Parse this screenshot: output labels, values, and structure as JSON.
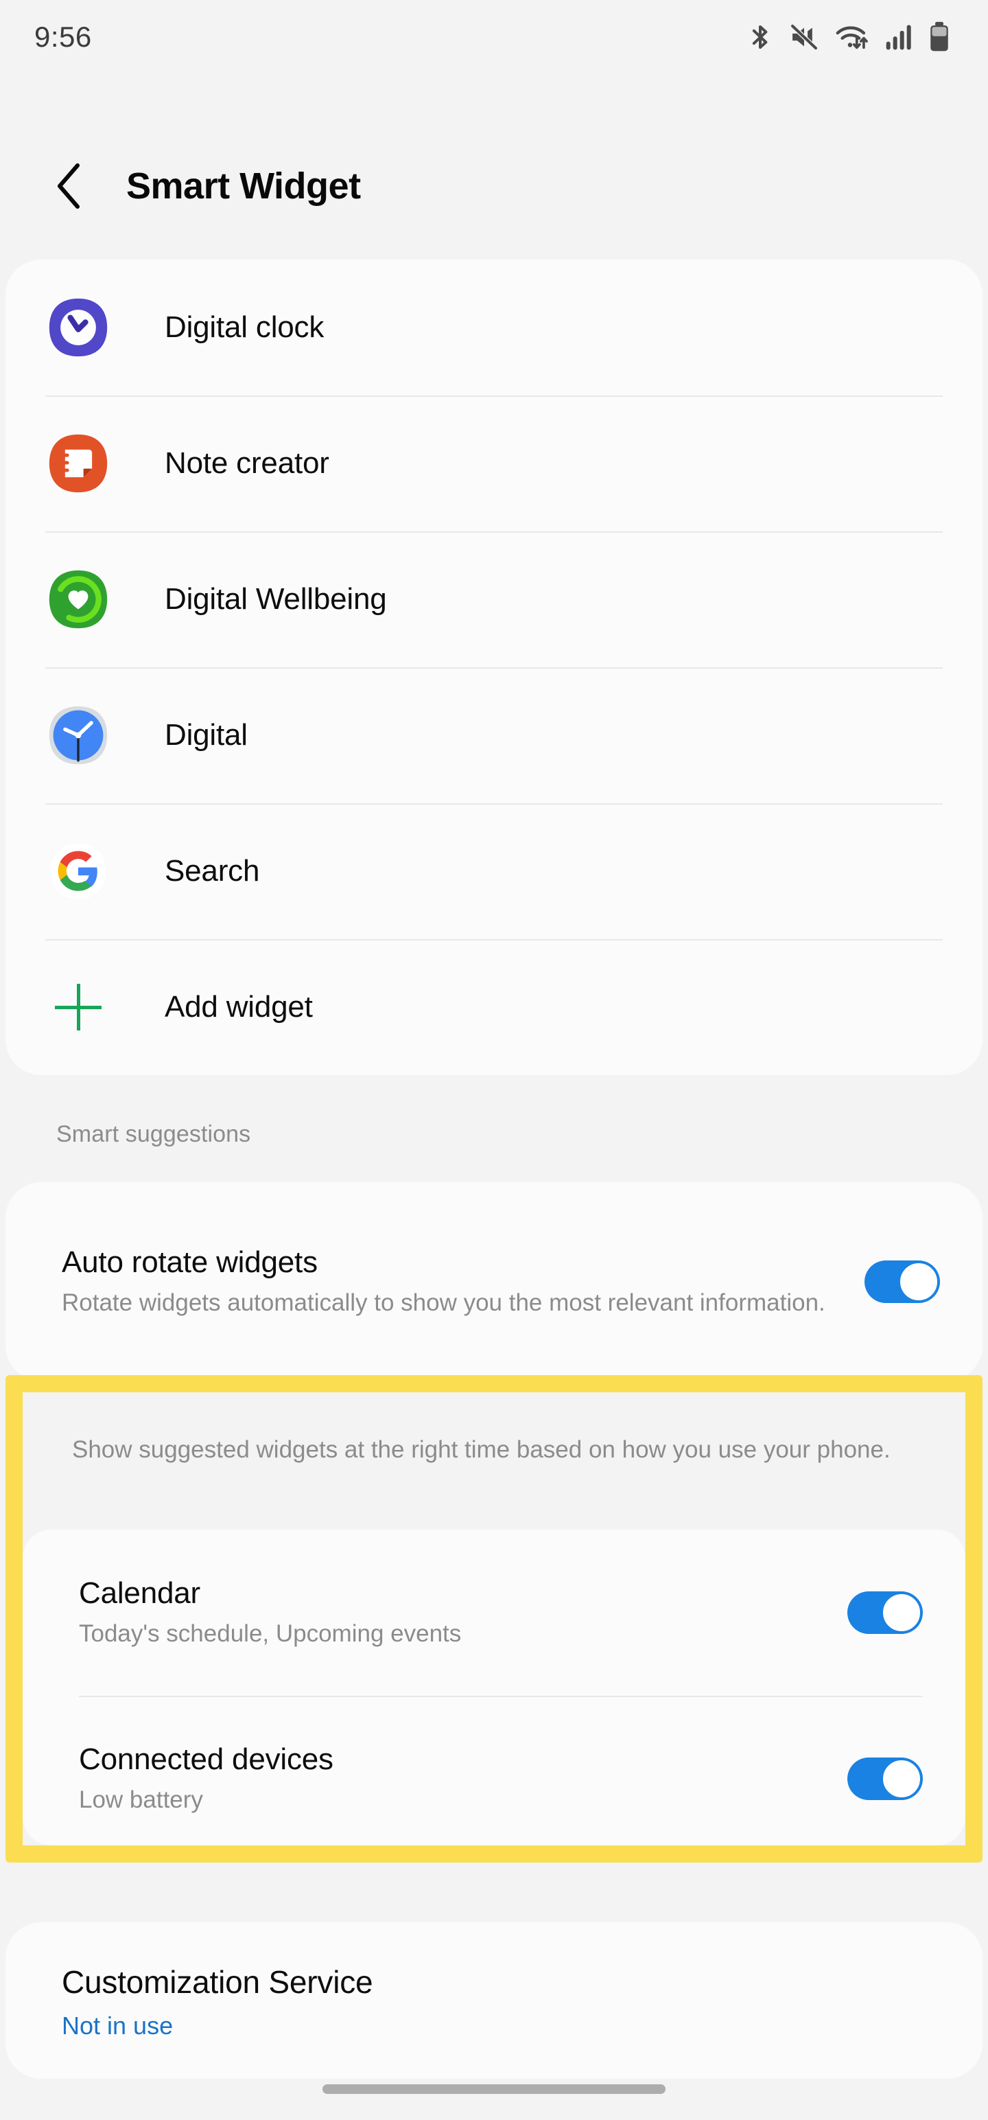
{
  "status_bar": {
    "time": "9:56",
    "icons": [
      {
        "name": "bluetooth-icon"
      },
      {
        "name": "sound-muted-icon"
      },
      {
        "name": "wifi-icon"
      },
      {
        "name": "cellular-signal-icon"
      },
      {
        "name": "battery-icon"
      }
    ]
  },
  "header": {
    "back_label": "Back",
    "title": "Smart Widget"
  },
  "widget_list": {
    "items": [
      {
        "label": "Digital clock",
        "icon": "digital-clock-icon"
      },
      {
        "label": "Note creator",
        "icon": "note-creator-icon"
      },
      {
        "label": "Digital Wellbeing",
        "icon": "digital-wellbeing-icon"
      },
      {
        "label": "Digital",
        "icon": "analog-clock-icon"
      },
      {
        "label": "Search",
        "icon": "google-search-icon"
      }
    ],
    "add_widget_label": "Add widget"
  },
  "smart_suggestions": {
    "section_label": "Smart suggestions",
    "auto_rotate": {
      "title": "Auto rotate widgets",
      "description": "Rotate widgets automatically to show you the most relevant information.",
      "toggle_on": true
    },
    "suggestion_description": "Show suggested widgets at the right time based on how you use your phone.",
    "items": [
      {
        "title": "Calendar",
        "subtitle": "Today's schedule, Upcoming events",
        "toggle_on": true
      },
      {
        "title": "Connected devices",
        "subtitle": "Low battery",
        "toggle_on": true
      }
    ]
  },
  "customization_service": {
    "title": "Customization Service",
    "status": "Not in use"
  },
  "colors": {
    "accent_blue": "#1a82e2",
    "link_blue": "#1a73c8",
    "highlight_yellow": "#fbdd52",
    "add_green": "#18a558",
    "page_background": "#f3f3f3",
    "card_background": "#fbfbfb"
  }
}
